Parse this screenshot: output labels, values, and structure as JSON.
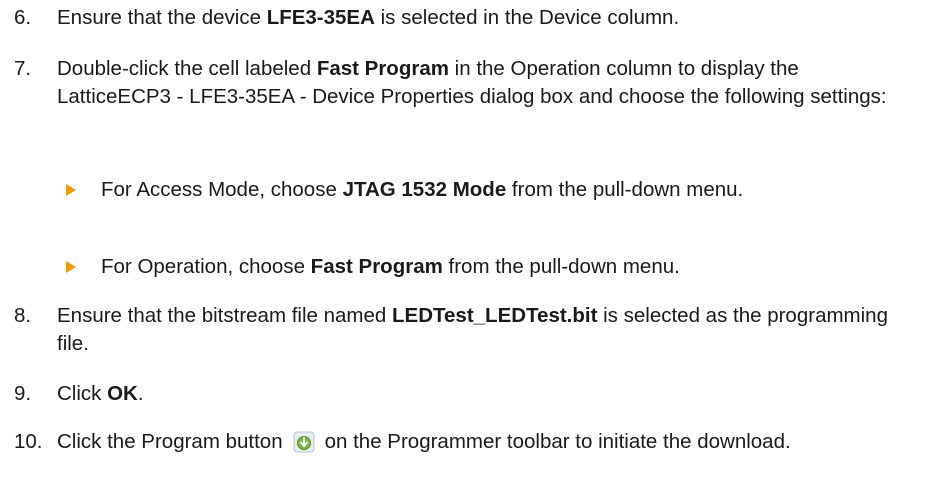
{
  "steps": {
    "s6": {
      "num": "6.",
      "pre": "Ensure that the device ",
      "bold": "LFE3-35EA",
      "post": " is selected in the Device column."
    },
    "s7": {
      "num": "7.",
      "pre": "Double-click the cell labeled ",
      "bold": "Fast Program",
      "post": " in the Operation column to display the LatticeECP3 - LFE3-35EA - Device Properties dialog box and choose the following settings:"
    },
    "s7a": {
      "pre": "For Access Mode, choose ",
      "bold": "JTAG 1532 Mode",
      "post": " from the pull-down menu."
    },
    "s7b": {
      "pre": "For Operation, choose ",
      "bold": "Fast Program",
      "post": " from the pull-down menu."
    },
    "s8": {
      "num": "8.",
      "pre": "Ensure that the bitstream file named ",
      "bold": "LEDTest_LEDTest.bit",
      "post": " is selected as the programming file."
    },
    "s9": {
      "num": "9.",
      "pre": "Click ",
      "bold": "OK",
      "post": "."
    },
    "s10": {
      "num": "10.",
      "pre": "Click the Program button",
      "post": "on the Programmer toolbar to initiate the download."
    }
  },
  "icons": {
    "program": "program-download-icon"
  },
  "colors": {
    "bullet": "#f39a00",
    "text": "#1a1a1a"
  }
}
